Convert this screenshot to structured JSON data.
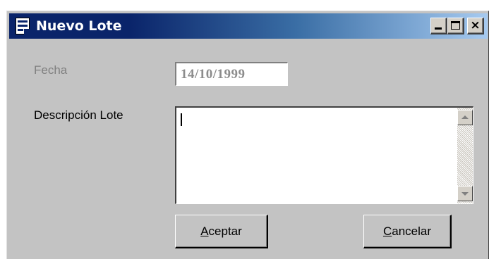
{
  "window": {
    "title": "Nuevo Lote",
    "controls": [
      "minimize",
      "maximize",
      "close"
    ],
    "title_bar_colors": [
      "#0a246a",
      "#a6caf0"
    ]
  },
  "form": {
    "fecha_label": "Fecha",
    "fecha_value": "14/10/1999",
    "descripcion_label": "Descripción Lote",
    "descripcion_value": ""
  },
  "buttons": {
    "accept_mnemonic": "A",
    "accept_rest": "ceptar",
    "cancel_mnemonic": "C",
    "cancel_rest": "ancelar"
  },
  "icons": {
    "title": "document-form-icon",
    "scroll_up": "arrow-up-icon",
    "scroll_down": "arrow-down-icon"
  }
}
